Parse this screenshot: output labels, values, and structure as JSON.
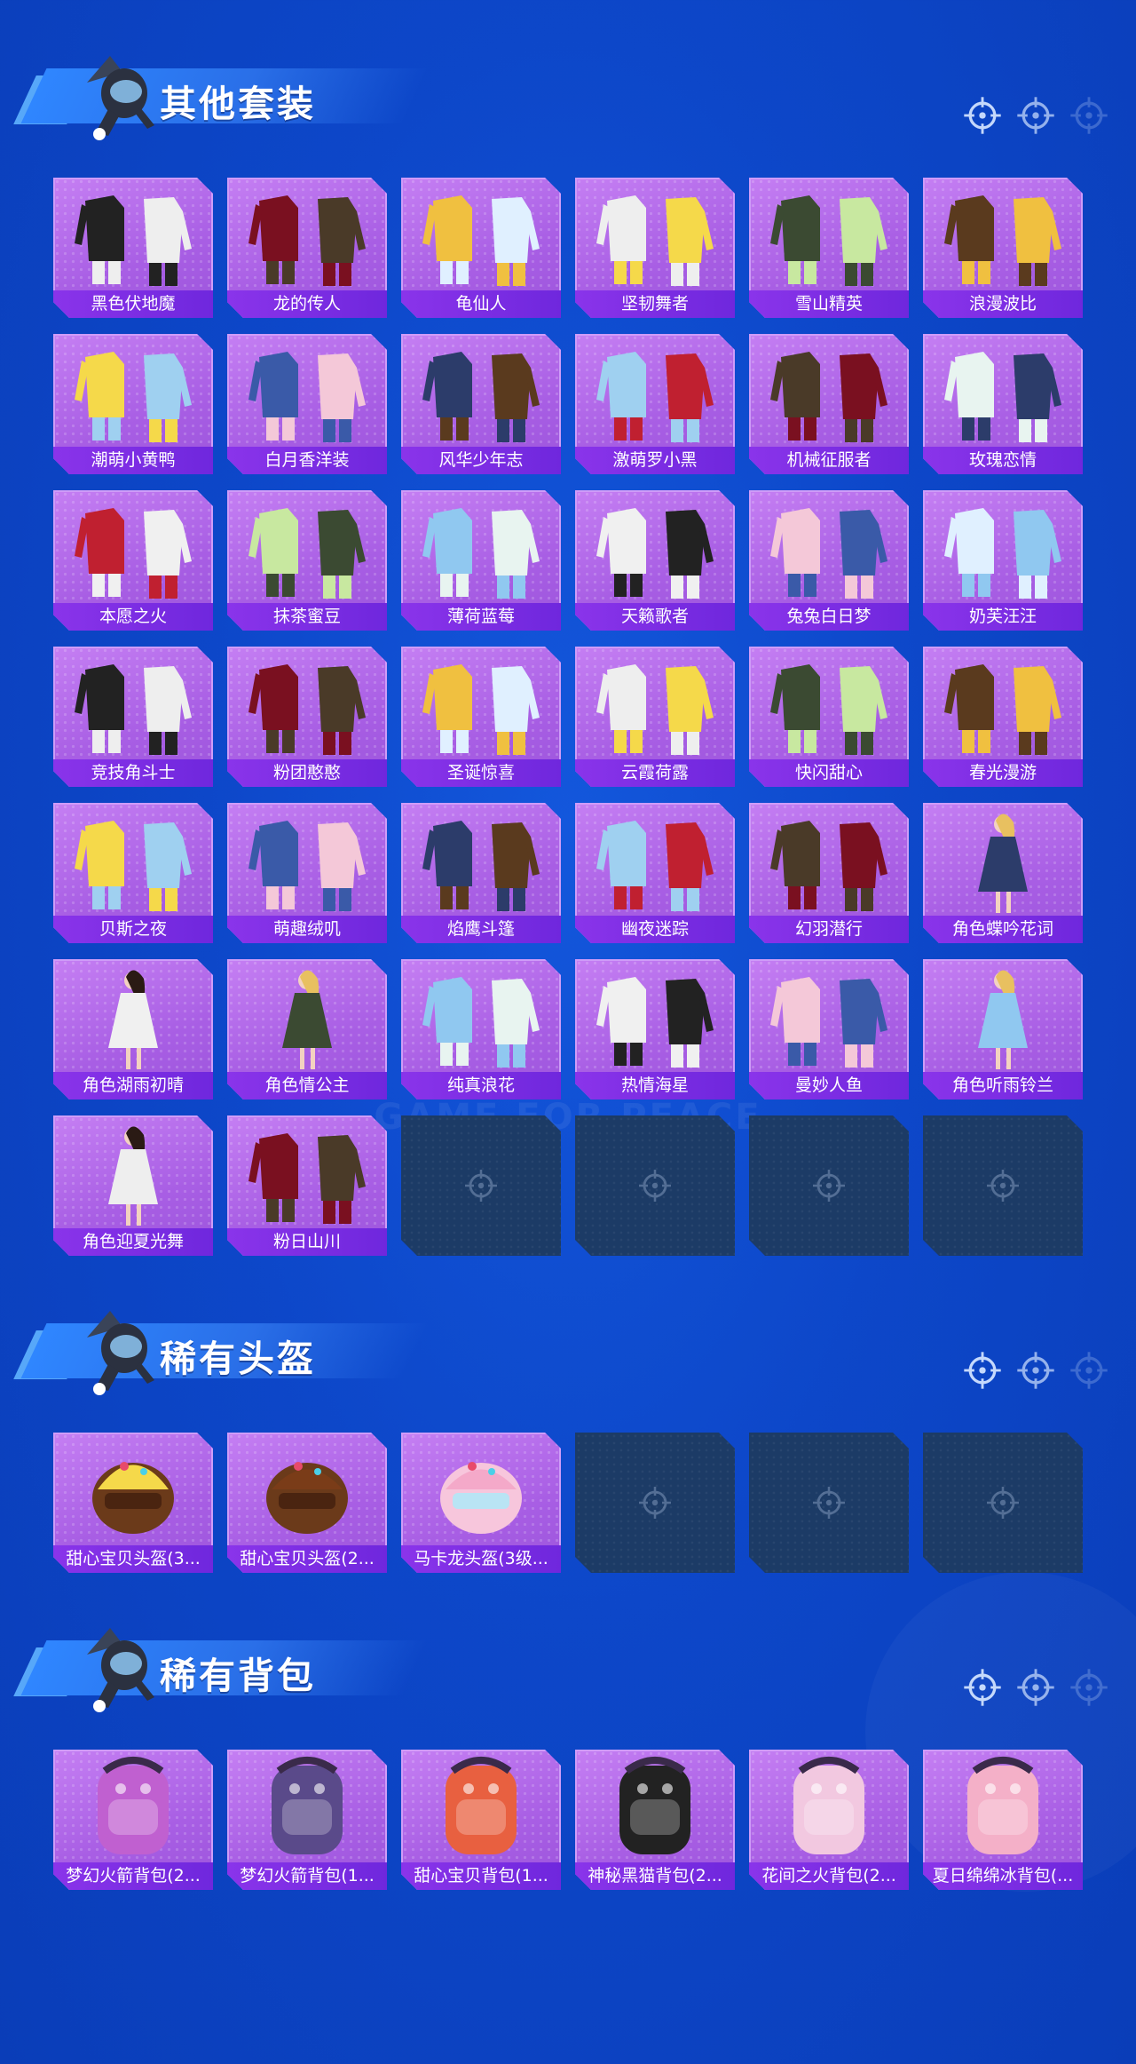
{
  "sections": [
    {
      "title": "其他套装",
      "items": [
        {
          "name": "黑色伏地魔",
          "icon": "outfit-icon"
        },
        {
          "name": "龙的传人",
          "icon": "outfit-icon"
        },
        {
          "name": "龟仙人",
          "icon": "outfit-icon"
        },
        {
          "name": "坚韧舞者",
          "icon": "outfit-icon"
        },
        {
          "name": "雪山精英",
          "icon": "outfit-icon"
        },
        {
          "name": "浪漫波比",
          "icon": "outfit-icon"
        },
        {
          "name": "潮萌小黄鸭",
          "icon": "outfit-icon"
        },
        {
          "name": "白月香洋装",
          "icon": "outfit-icon"
        },
        {
          "name": "风华少年志",
          "icon": "outfit-icon"
        },
        {
          "name": "激萌罗小黑",
          "icon": "outfit-icon"
        },
        {
          "name": "机械征服者",
          "icon": "outfit-icon"
        },
        {
          "name": "玫瑰恋情",
          "icon": "outfit-icon"
        },
        {
          "name": "本愿之火",
          "icon": "outfit-icon"
        },
        {
          "name": "抹茶蜜豆",
          "icon": "outfit-icon"
        },
        {
          "name": "薄荷蓝莓",
          "icon": "outfit-icon"
        },
        {
          "name": "天籁歌者",
          "icon": "outfit-icon"
        },
        {
          "name": "兔兔白日梦",
          "icon": "outfit-icon"
        },
        {
          "name": "奶芙汪汪",
          "icon": "outfit-icon"
        },
        {
          "name": "竞技角斗士",
          "icon": "outfit-icon"
        },
        {
          "name": "粉团憨憨",
          "icon": "outfit-icon"
        },
        {
          "name": "圣诞惊喜",
          "icon": "outfit-icon"
        },
        {
          "name": "云霞荷露",
          "icon": "outfit-icon"
        },
        {
          "name": "快闪甜心",
          "icon": "outfit-icon"
        },
        {
          "name": "春光漫游",
          "icon": "outfit-icon"
        },
        {
          "name": "贝斯之夜",
          "icon": "outfit-icon"
        },
        {
          "name": "萌趣绒叽",
          "icon": "outfit-icon"
        },
        {
          "name": "焰鹰斗篷",
          "icon": "outfit-icon"
        },
        {
          "name": "幽夜迷踪",
          "icon": "outfit-icon"
        },
        {
          "name": "幻羽潜行",
          "icon": "outfit-icon"
        },
        {
          "name": "角色蝶吟花词",
          "icon": "character-icon"
        },
        {
          "name": "角色湖雨初晴",
          "icon": "character-icon"
        },
        {
          "name": "角色情公主",
          "icon": "character-icon"
        },
        {
          "name": "纯真浪花",
          "icon": "outfit-icon"
        },
        {
          "name": "热情海星",
          "icon": "outfit-icon"
        },
        {
          "name": "曼妙人鱼",
          "icon": "outfit-icon"
        },
        {
          "name": "角色听雨铃兰",
          "icon": "character-icon"
        },
        {
          "name": "角色迎夏光舞",
          "icon": "character-icon"
        },
        {
          "name": "粉日山川",
          "icon": "outfit-icon"
        }
      ],
      "empty_slots": 4
    },
    {
      "title": "稀有头盔",
      "items": [
        {
          "name": "甜心宝贝头盔(3...",
          "icon": "helmet-icon"
        },
        {
          "name": "甜心宝贝头盔(2...",
          "icon": "helmet-icon"
        },
        {
          "name": "马卡龙头盔(3级...",
          "icon": "helmet-icon"
        }
      ],
      "empty_slots": 3
    },
    {
      "title": "稀有背包",
      "items": [
        {
          "name": "梦幻火箭背包(2...",
          "icon": "backpack-icon"
        },
        {
          "name": "梦幻火箭背包(1...",
          "icon": "backpack-icon"
        },
        {
          "name": "甜心宝贝背包(1...",
          "icon": "backpack-icon"
        },
        {
          "name": "神秘黑猫背包(2...",
          "icon": "backpack-icon"
        },
        {
          "name": "花间之火背包(2...",
          "icon": "backpack-icon"
        },
        {
          "name": "夏日绵绵冰背包(...",
          "icon": "backpack-icon"
        }
      ],
      "empty_slots": 0
    }
  ],
  "watermark": "GAME FOR PEACE",
  "colors": {
    "background": "#0d47c9",
    "card": "#b76dec",
    "label_bar": "#7a2de3",
    "empty_slot": "#1c3b66"
  }
}
